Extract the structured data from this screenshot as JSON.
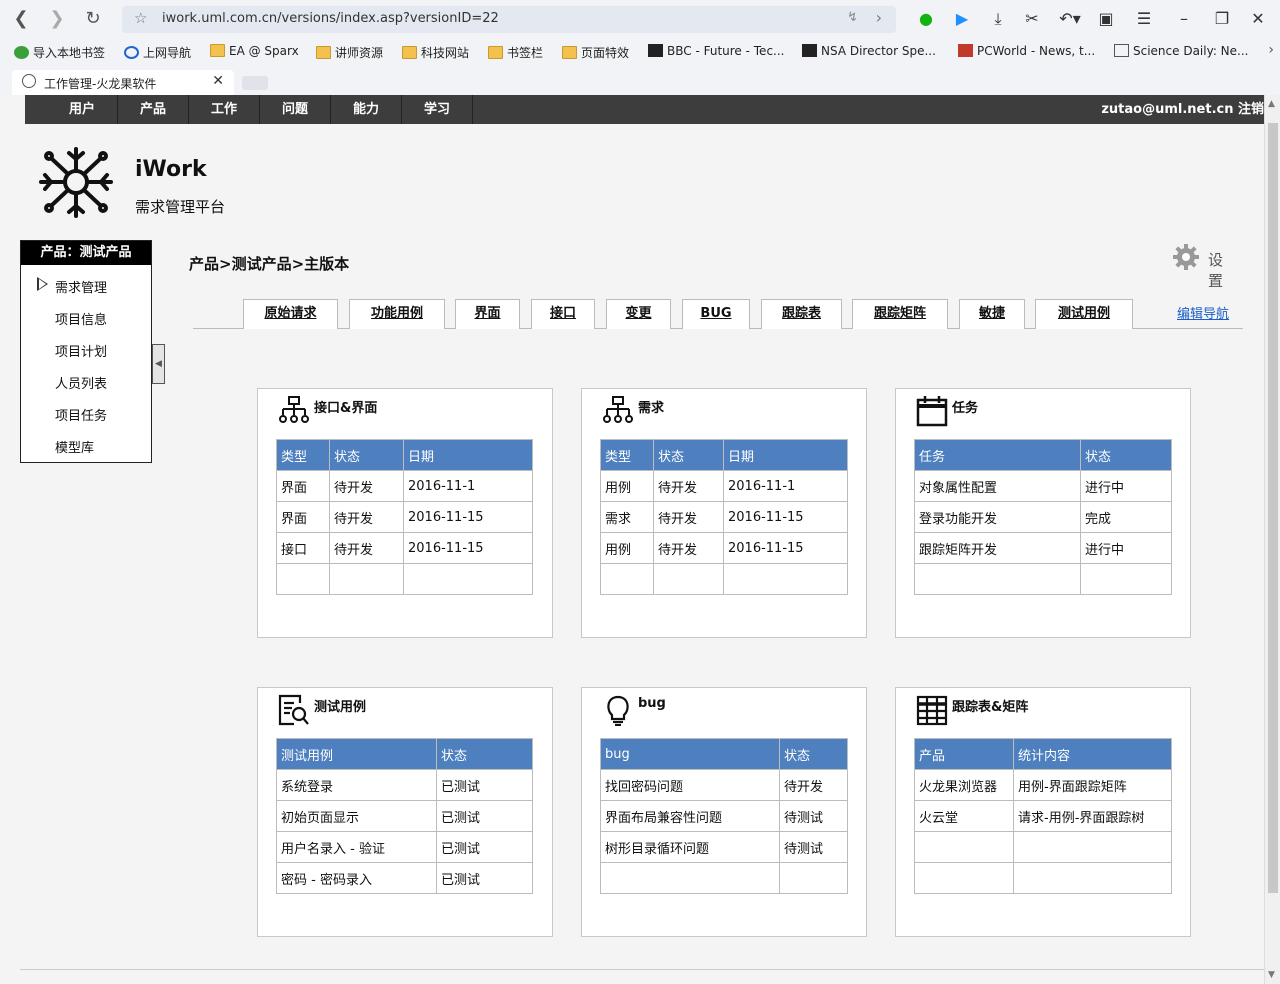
{
  "browser": {
    "url": "iwork.uml.com.cn/versions/index.asp?versionID=22",
    "bookmarks": [
      "导入本地书签",
      "上网导航",
      "EA @ Sparx",
      "讲师资源",
      "科技网站",
      "书签栏",
      "页面特效",
      "BBC - Future - Tec...",
      "NSA Director Spe...",
      "PCWorld - News, t...",
      "Science Daily: Ne..."
    ],
    "tab_title": "工作管理-火龙果软件"
  },
  "topnav": {
    "items": [
      "用户",
      "产品",
      "工作",
      "问题",
      "能力",
      "学习"
    ],
    "user": "zutao@uml.net.cn 注销"
  },
  "brand": {
    "name": "iWork",
    "subtitle": "需求管理平台"
  },
  "sidebar": {
    "header": "产品：测试产品",
    "items": [
      "需求管理",
      "项目信息",
      "项目计划",
      "人员列表",
      "项目任务",
      "模型库"
    ]
  },
  "breadcrumb": "产品>测试产品>主版本",
  "settings_label": "设置",
  "product_tabs": [
    "原始请求",
    "功能用例",
    "界面",
    "接口",
    "变更",
    "BUG",
    "跟踪表",
    "跟踪矩阵",
    "敏捷",
    "测试用例"
  ],
  "edit_nav": "编辑导航",
  "cards": {
    "interface": {
      "title": "接口&界面",
      "headers": [
        "类型",
        "状态",
        "日期"
      ],
      "rows": [
        [
          "界面",
          "待开发",
          "2016-11-1"
        ],
        [
          "界面",
          "待开发",
          "2016-11-15"
        ],
        [
          "接口",
          "待开发",
          "2016-11-15"
        ],
        [
          "",
          "",
          ""
        ]
      ]
    },
    "requirements": {
      "title": "需求",
      "headers": [
        "类型",
        "状态",
        "日期"
      ],
      "rows": [
        [
          "用例",
          "待开发",
          "2016-11-1"
        ],
        [
          "需求",
          "待开发",
          "2016-11-15"
        ],
        [
          "用例",
          "待开发",
          "2016-11-15"
        ],
        [
          "",
          "",
          ""
        ]
      ]
    },
    "tasks": {
      "title": "任务",
      "headers": [
        "任务",
        "状态"
      ],
      "rows": [
        [
          "对象属性配置",
          "进行中"
        ],
        [
          "登录功能开发",
          "完成"
        ],
        [
          "跟踪矩阵开发",
          "进行中"
        ],
        [
          "",
          ""
        ]
      ]
    },
    "testcases": {
      "title": "测试用例",
      "headers": [
        "测试用例",
        "状态"
      ],
      "rows": [
        [
          "系统登录",
          "已测试"
        ],
        [
          "初始页面显示",
          "已测试"
        ],
        [
          "用户名录入 - 验证",
          "已测试"
        ],
        [
          "密码 - 密码录入",
          "已测试"
        ]
      ]
    },
    "bugs": {
      "title": "bug",
      "headers": [
        "bug",
        "状态"
      ],
      "rows": [
        [
          "找回密码问题",
          "待开发"
        ],
        [
          "界面布局兼容性问题",
          "待测试"
        ],
        [
          "树形目录循环问题",
          "待测试"
        ],
        [
          "",
          ""
        ]
      ]
    },
    "trace": {
      "title": "跟踪表&矩阵",
      "headers": [
        "产品",
        "统计内容"
      ],
      "rows": [
        [
          "火龙果浏览器",
          "用例-界面跟踪矩阵"
        ],
        [
          "火云堂",
          "请求-用例-界面跟踪树"
        ],
        [
          "",
          ""
        ],
        [
          "",
          ""
        ]
      ]
    }
  },
  "colors": {
    "table_header": "#4e7fbe",
    "nav_bg": "#3d3d3d",
    "link": "#1a5dc8"
  }
}
